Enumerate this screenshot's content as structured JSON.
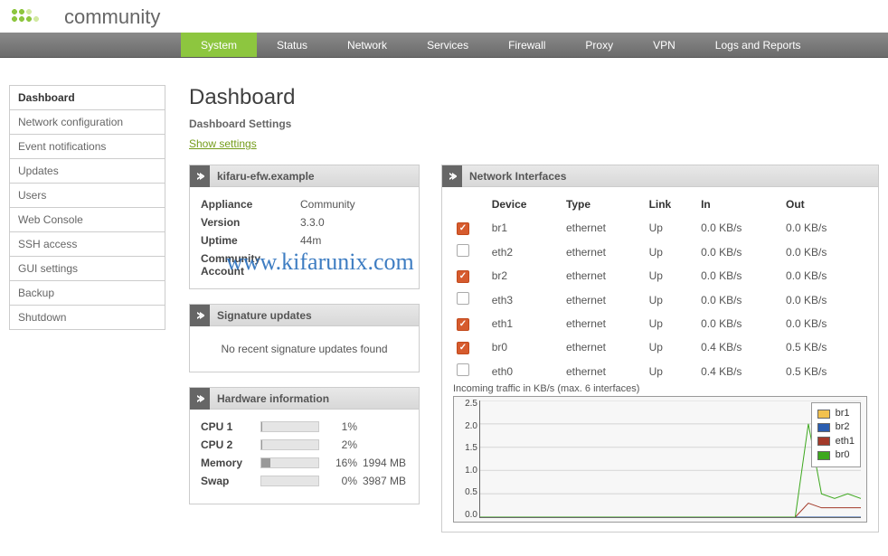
{
  "brand": {
    "text": "community"
  },
  "topnav": {
    "items": [
      {
        "label": "System"
      },
      {
        "label": "Status"
      },
      {
        "label": "Network"
      },
      {
        "label": "Services"
      },
      {
        "label": "Firewall"
      },
      {
        "label": "Proxy"
      },
      {
        "label": "VPN"
      },
      {
        "label": "Logs and Reports"
      }
    ],
    "active_index": 0
  },
  "sidebar": {
    "items": [
      {
        "label": "Dashboard"
      },
      {
        "label": "Network configuration"
      },
      {
        "label": "Event notifications"
      },
      {
        "label": "Updates"
      },
      {
        "label": "Users"
      },
      {
        "label": "Web Console"
      },
      {
        "label": "SSH access"
      },
      {
        "label": "GUI settings"
      },
      {
        "label": "Backup"
      },
      {
        "label": "Shutdown"
      }
    ],
    "active_index": 0
  },
  "page": {
    "title": "Dashboard",
    "settings_heading": "Dashboard Settings",
    "show_settings": "Show settings"
  },
  "host_panel": {
    "title": "kifaru-efw.example",
    "appliance_label": "Appliance",
    "appliance": "Community",
    "version_label": "Version",
    "version": "3.3.0",
    "uptime_label": "Uptime",
    "uptime": "44m",
    "community_label": "Community Account",
    "community": ""
  },
  "sig_panel": {
    "title": "Signature updates",
    "empty_msg": "No recent signature updates found"
  },
  "hw_panel": {
    "title": "Hardware information",
    "rows": [
      {
        "label": "CPU 1",
        "pct": "1%",
        "fill": 1,
        "extra": ""
      },
      {
        "label": "CPU 2",
        "pct": "2%",
        "fill": 2,
        "extra": ""
      },
      {
        "label": "Memory",
        "pct": "16%",
        "fill": 16,
        "extra": "1994 MB"
      },
      {
        "label": "Swap",
        "pct": "0%",
        "fill": 0,
        "extra": "3987 MB"
      }
    ]
  },
  "net_panel": {
    "title": "Network Interfaces",
    "cols": {
      "device": "Device",
      "type": "Type",
      "link": "Link",
      "in": "In",
      "out": "Out"
    },
    "rows": [
      {
        "checked": true,
        "device": "br1",
        "cls": "dev-orange",
        "type": "ethernet",
        "link": "Up",
        "in": "0.0 KB/s",
        "out": "0.0 KB/s"
      },
      {
        "checked": false,
        "device": "eth2",
        "cls": "dev-blue",
        "type": "ethernet",
        "link": "Up",
        "in": "0.0 KB/s",
        "out": "0.0 KB/s"
      },
      {
        "checked": true,
        "device": "br2",
        "cls": "dev-blue",
        "type": "ethernet",
        "link": "Up",
        "in": "0.0 KB/s",
        "out": "0.0 KB/s"
      },
      {
        "checked": false,
        "device": "eth3",
        "cls": "dev-blue",
        "type": "ethernet",
        "link": "Up",
        "in": "0.0 KB/s",
        "out": "0.0 KB/s"
      },
      {
        "checked": true,
        "device": "eth1",
        "cls": "dev-orange",
        "type": "ethernet",
        "link": "Up",
        "in": "0.0 KB/s",
        "out": "0.0 KB/s"
      },
      {
        "checked": true,
        "device": "br0",
        "cls": "dev-green",
        "type": "ethernet",
        "link": "Up",
        "in": "0.4 KB/s",
        "out": "0.5 KB/s"
      },
      {
        "checked": false,
        "device": "eth0",
        "cls": "dev-green",
        "type": "ethernet",
        "link": "Up",
        "in": "0.4 KB/s",
        "out": "0.5 KB/s"
      }
    ]
  },
  "chart": {
    "caption": "Incoming traffic in KB/s (max. 6 interfaces)",
    "ylabels": [
      "2.5",
      "2.0",
      "1.5",
      "1.0",
      "0.5",
      "0.0"
    ],
    "legend": [
      {
        "label": "br1",
        "color": "#f2c14e"
      },
      {
        "label": "br2",
        "color": "#2a5db0"
      },
      {
        "label": "eth1",
        "color": "#a33a2a"
      },
      {
        "label": "br0",
        "color": "#3da81e"
      }
    ]
  },
  "watermark": "www.kifarunix.com",
  "chart_data": {
    "type": "line",
    "title": "Incoming traffic in KB/s (max. 6 interfaces)",
    "ylabel": "KB/s",
    "ylim": [
      0,
      2.5
    ],
    "x": [
      0,
      1,
      2,
      3,
      4,
      5,
      6,
      7,
      8,
      9,
      10,
      11,
      12,
      13,
      14,
      15,
      16,
      17,
      18,
      19,
      20,
      21,
      22,
      23,
      24,
      25,
      26,
      27,
      28,
      29
    ],
    "series": [
      {
        "name": "br1",
        "color": "#f2c14e",
        "values": [
          0,
          0,
          0,
          0,
          0,
          0,
          0,
          0,
          0,
          0,
          0,
          0,
          0,
          0,
          0,
          0,
          0,
          0,
          0,
          0,
          0,
          0,
          0,
          0,
          0,
          0,
          0,
          0,
          0,
          0
        ]
      },
      {
        "name": "br2",
        "color": "#2a5db0",
        "values": [
          0,
          0,
          0,
          0,
          0,
          0,
          0,
          0,
          0,
          0,
          0,
          0,
          0,
          0,
          0,
          0,
          0,
          0,
          0,
          0,
          0,
          0,
          0,
          0,
          0,
          0,
          0,
          0,
          0,
          0
        ]
      },
      {
        "name": "eth1",
        "color": "#a33a2a",
        "values": [
          0,
          0,
          0,
          0,
          0,
          0,
          0,
          0,
          0,
          0,
          0,
          0,
          0,
          0,
          0,
          0,
          0,
          0,
          0,
          0,
          0,
          0,
          0,
          0,
          0,
          0.3,
          0.2,
          0.2,
          0.2,
          0.2
        ]
      },
      {
        "name": "br0",
        "color": "#3da81e",
        "values": [
          0,
          0,
          0,
          0,
          0,
          0,
          0,
          0,
          0,
          0,
          0,
          0,
          0,
          0,
          0,
          0,
          0,
          0,
          0,
          0,
          0,
          0,
          0,
          0,
          0,
          2.0,
          0.5,
          0.4,
          0.5,
          0.4
        ]
      }
    ]
  }
}
